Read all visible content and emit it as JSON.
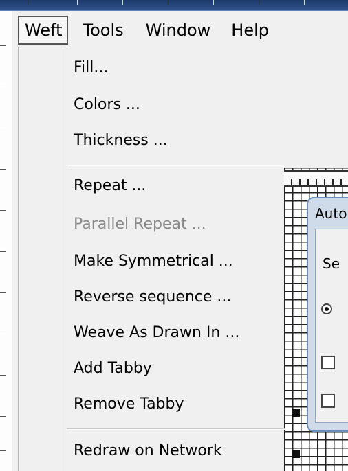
{
  "menubar": {
    "items": [
      {
        "label": "Weft",
        "active": true
      },
      {
        "label": "Tools"
      },
      {
        "label": "Window"
      },
      {
        "label": "Help"
      }
    ]
  },
  "weft_menu": {
    "items": [
      {
        "label": "Fill...",
        "enabled": true
      },
      {
        "label": "Colors ...",
        "enabled": true
      },
      {
        "label": "Thickness ...",
        "enabled": true
      },
      {
        "label": "Repeat ...",
        "enabled": true
      },
      {
        "label": "Parallel Repeat ...",
        "enabled": false
      },
      {
        "label": "Make Symmetrical ...",
        "enabled": true
      },
      {
        "label": "Reverse sequence ...",
        "enabled": true
      },
      {
        "label": "Weave As Drawn In ...",
        "enabled": true
      },
      {
        "label": "Add Tabby",
        "enabled": true
      },
      {
        "label": "Remove Tabby",
        "enabled": true
      },
      {
        "label": "Redraw on Network",
        "enabled": true
      }
    ]
  },
  "dialog": {
    "title": "Auto",
    "label": "Se"
  },
  "colors": {
    "menu_bg": "#f0f0f0",
    "disabled_text": "#8a8a8a",
    "dialog_frame": "#cfdbe8",
    "top_strip": "#1d3a6b"
  }
}
